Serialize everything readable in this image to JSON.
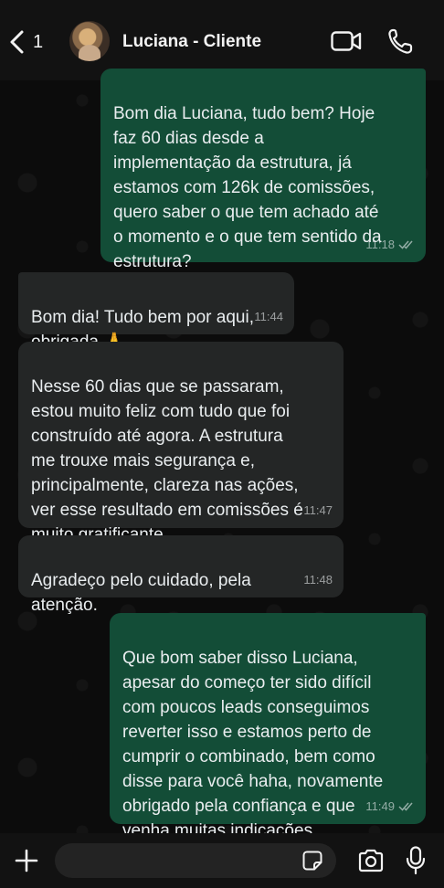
{
  "header": {
    "back_count": "1",
    "contact_name": "Luciana - Cliente",
    "icons": [
      "chevron-left-icon",
      "video-call-icon",
      "phone-call-icon"
    ]
  },
  "messages": [
    {
      "direction": "outgoing",
      "text": "Bom dia Luciana, tudo bem? Hoje\nfaz 60 dias desde a\nimplementação da estrutura, já\nestamos com 126k de comissões,\nquero saber o que tem achado até\no momento e o que tem sentido da\nestrutura?",
      "time": "11:18",
      "status": "read"
    },
    {
      "direction": "incoming",
      "text": "Bom dia! Tudo bem por aqui,\nobrigada 🙏",
      "time": "11:44"
    },
    {
      "direction": "incoming",
      "text": "Nesse 60 dias que se passaram,\nestou muito feliz com tudo que foi\nconstruído até agora. A estrutura\nme trouxe mais segurança e,\nprincipalmente, clareza nas ações,\nver esse resultado em comissões é\nmuito gratificante.",
      "time": "11:47"
    },
    {
      "direction": "incoming",
      "text": "Agradeço pelo cuidado, pela\natenção.",
      "time": "11:48"
    },
    {
      "direction": "outgoing",
      "text": "Que bom saber disso Luciana,\napesar do começo ter sido difícil\ncom poucos leads conseguimos\nreverter isso e estamos perto de\ncumprir o combinado, bem como\ndisse para você haha, novamente\nobrigado pela confiança e que\nvenha muitas indicações",
      "time": "11:49",
      "status": "read"
    }
  ],
  "composer": {
    "value": "",
    "icons": [
      "plus-icon",
      "sticker-icon",
      "camera-icon",
      "microphone-icon"
    ]
  },
  "colors": {
    "outgoing_bubble": "#134d37",
    "incoming_bubble": "#242626",
    "background": "#0c0c0c"
  }
}
